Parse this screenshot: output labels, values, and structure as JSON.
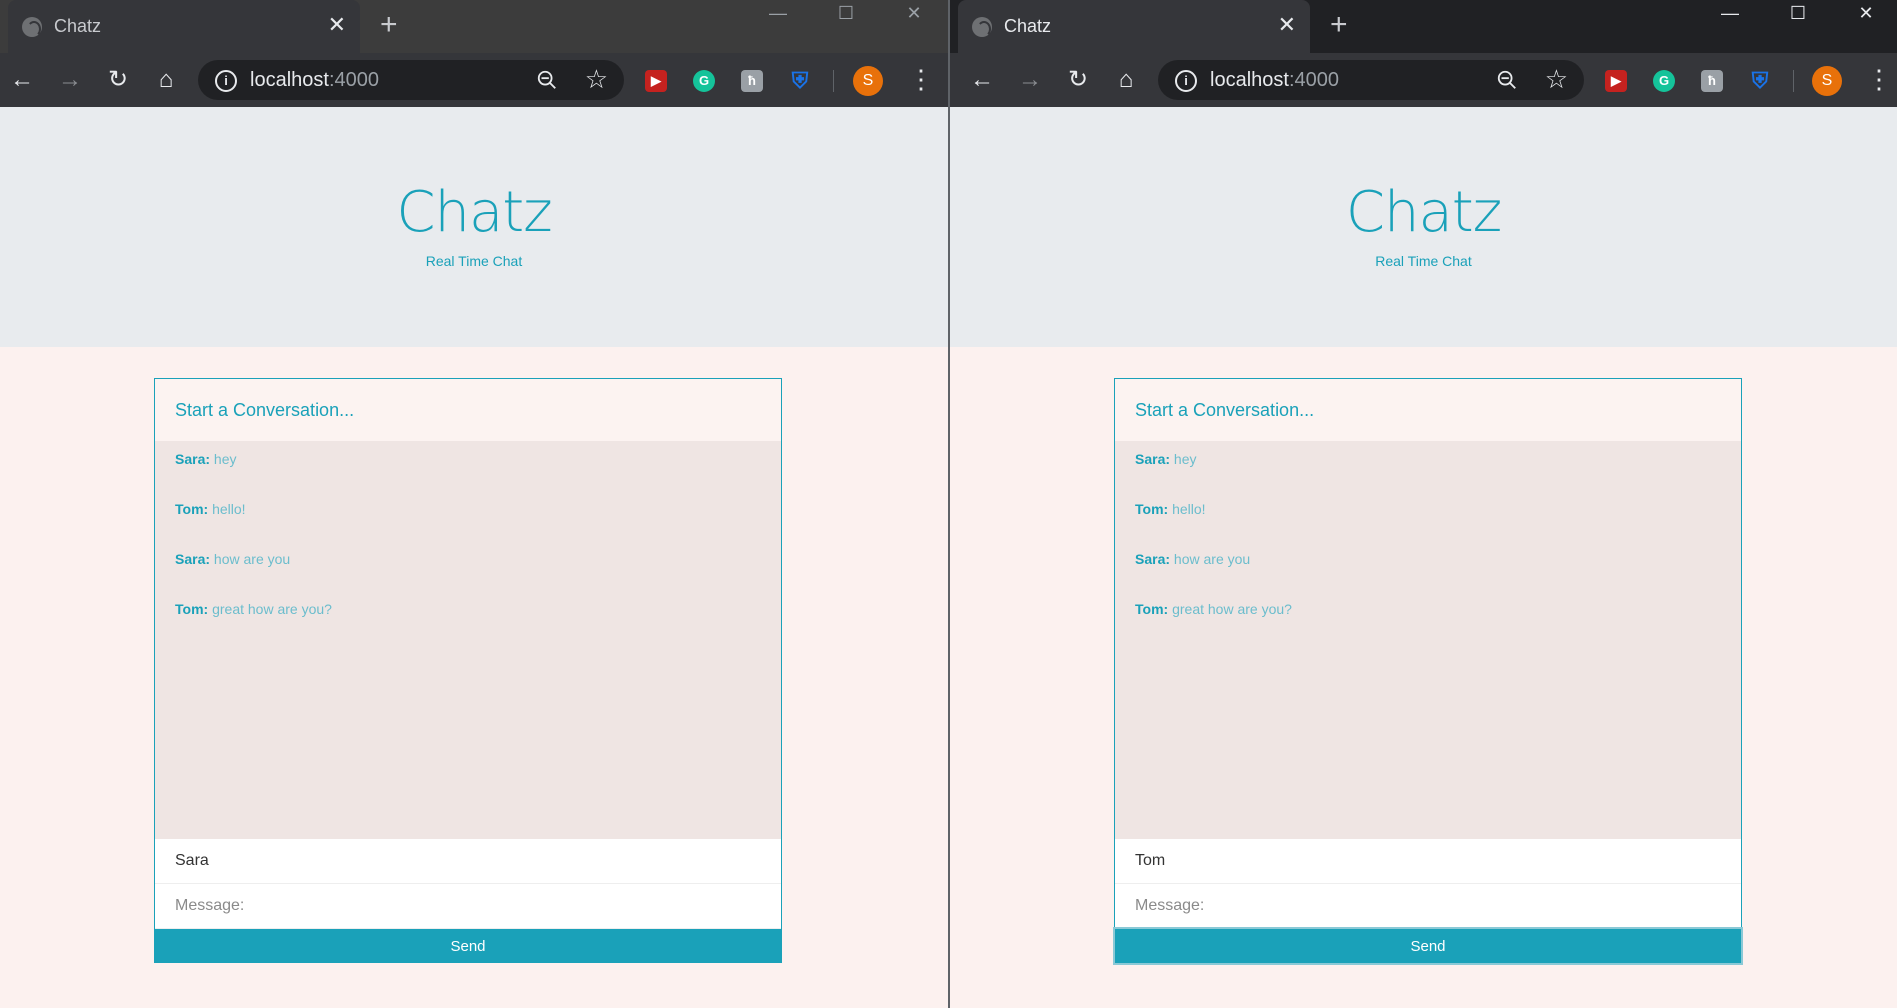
{
  "windows": [
    {
      "tab": {
        "title": "Chatz",
        "close": "✕"
      },
      "new_tab": "+",
      "window_controls": {
        "minimize": "—",
        "maximize": "☐",
        "close": "✕"
      },
      "omnibox": {
        "host": "localhost",
        "port": ":4000"
      },
      "avatar_letter": "S",
      "page": {
        "title": "Chatz",
        "subtitle": "Real Time Chat",
        "chat_header": "Start a Conversation...",
        "messages": [
          {
            "from": "Sara:",
            "text": "hey"
          },
          {
            "from": "Tom:",
            "text": "hello!"
          },
          {
            "from": "Sara:",
            "text": "how are you"
          },
          {
            "from": "Tom:",
            "text": "great how are you?"
          }
        ],
        "name_value": "Sara",
        "message_placeholder": "Message:",
        "send_label": "Send"
      }
    },
    {
      "tab": {
        "title": "Chatz",
        "close": "✕"
      },
      "new_tab": "+",
      "window_controls": {
        "minimize": "—",
        "maximize": "☐",
        "close": "✕"
      },
      "omnibox": {
        "host": "localhost",
        "port": ":4000"
      },
      "avatar_letter": "S",
      "page": {
        "title": "Chatz",
        "subtitle": "Real Time Chat",
        "chat_header": "Start a Conversation...",
        "messages": [
          {
            "from": "Sara:",
            "text": "hey"
          },
          {
            "from": "Tom:",
            "text": "hello!"
          },
          {
            "from": "Sara:",
            "text": "how are you"
          },
          {
            "from": "Tom:",
            "text": "great how are you?"
          }
        ],
        "name_value": "Tom",
        "message_placeholder": "Message:",
        "send_label": "Send"
      }
    }
  ],
  "icons": [
    "globe-icon",
    "back-arrow-icon",
    "forward-arrow-icon",
    "reload-icon",
    "home-icon",
    "info-icon",
    "zoom-icon",
    "star-icon",
    "extension-icon",
    "shield-icon",
    "menu-dots-icon"
  ],
  "colors": {
    "accent": "#1aa1b9",
    "hero_bg": "#e8ebee",
    "page_bg": "#fcf1ef",
    "messages_bg": "#efe5e3"
  }
}
